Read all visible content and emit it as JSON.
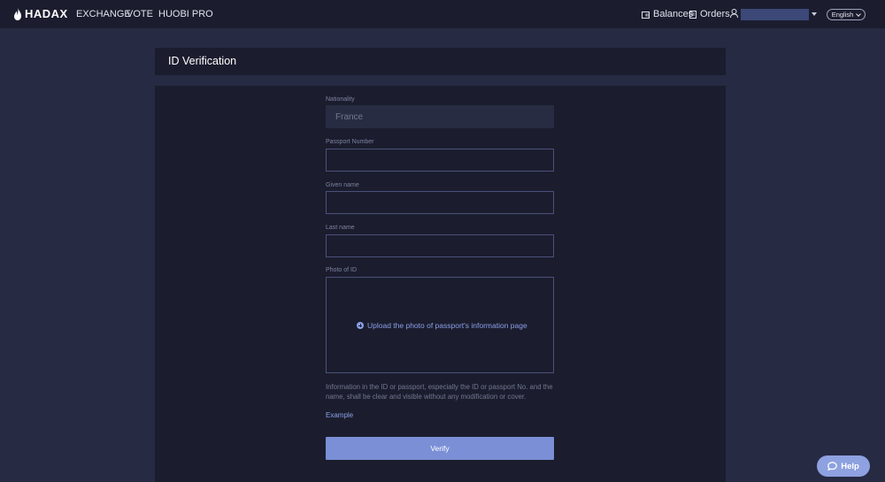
{
  "header": {
    "brand": "HADAX",
    "nav": [
      "EXCHANGE",
      "VOTE",
      "HUOBI PRO"
    ],
    "balances_label": "Balances",
    "orders_label": "Orders",
    "language": "English"
  },
  "page": {
    "title": "ID Verification"
  },
  "form": {
    "nationality_label": "Nationality",
    "nationality_value": "France",
    "passport_label": "Passport Number",
    "passport_value": "",
    "given_name_label": "Given name",
    "given_name_value": "",
    "last_name_label": "Last name",
    "last_name_value": "",
    "photo_label": "Photo of ID",
    "upload_text": "Upload the photo of passport's information page",
    "info_text": "Information in the ID or passport, especially the ID or passport No. and the name, shall be clear and visible without any modification or cover.",
    "example_link": "Example",
    "verify_button": "Verify"
  },
  "help_button": "Help",
  "colors": {
    "background": "#262a43",
    "panel": "#1b1d2e",
    "accent": "#7a8fd6",
    "link": "#8aa0e6"
  }
}
